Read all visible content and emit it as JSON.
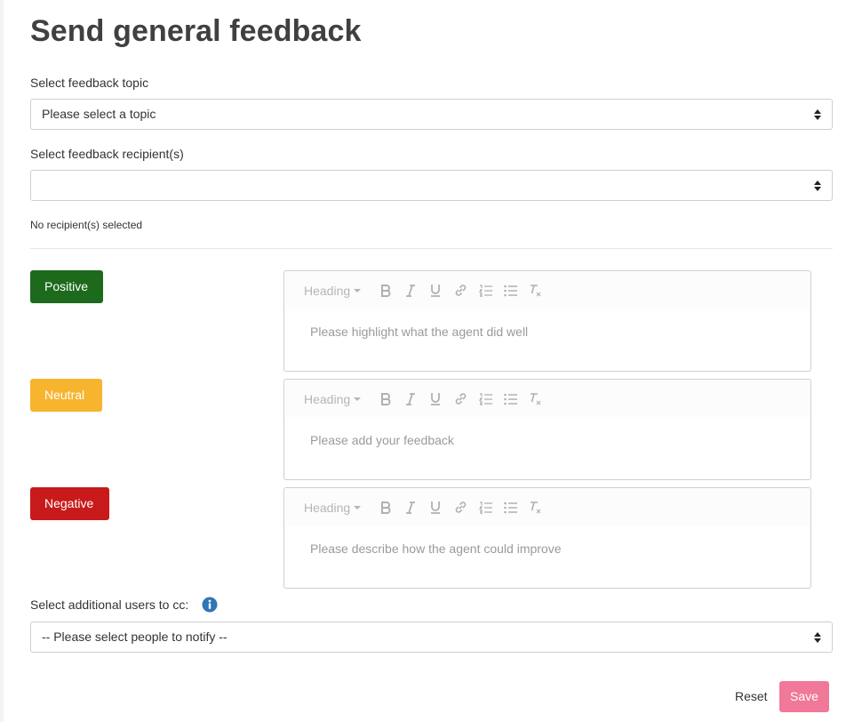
{
  "page": {
    "title": "Send general feedback"
  },
  "topic": {
    "label": "Select feedback topic",
    "value": "Please select a topic"
  },
  "recipients": {
    "label": "Select feedback recipient(s)",
    "value": "",
    "hint": "No recipient(s) selected"
  },
  "sentiments": [
    {
      "badge": "Positive",
      "color": "#1d6a1d",
      "toolbar": {
        "heading": "Heading"
      },
      "placeholder": "Please highlight what the agent did well"
    },
    {
      "badge": "Neutral",
      "color": "#f7b42e",
      "toolbar": {
        "heading": "Heading"
      },
      "placeholder": "Please add your feedback"
    },
    {
      "badge": "Negative",
      "color": "#c81a1a",
      "toolbar": {
        "heading": "Heading"
      },
      "placeholder": "Please describe how the agent could improve"
    }
  ],
  "cc": {
    "label": "Select additional users to cc:",
    "value": "-- Please select people to notify --",
    "info_icon": "info-icon"
  },
  "actions": {
    "reset_label": "Reset",
    "save_label": "Save",
    "save_color": "#f07898"
  },
  "toolbar_icons": [
    "bold-icon",
    "italic-icon",
    "underline-icon",
    "link-icon",
    "ordered-list-icon",
    "bullet-list-icon",
    "clear-format-icon"
  ]
}
